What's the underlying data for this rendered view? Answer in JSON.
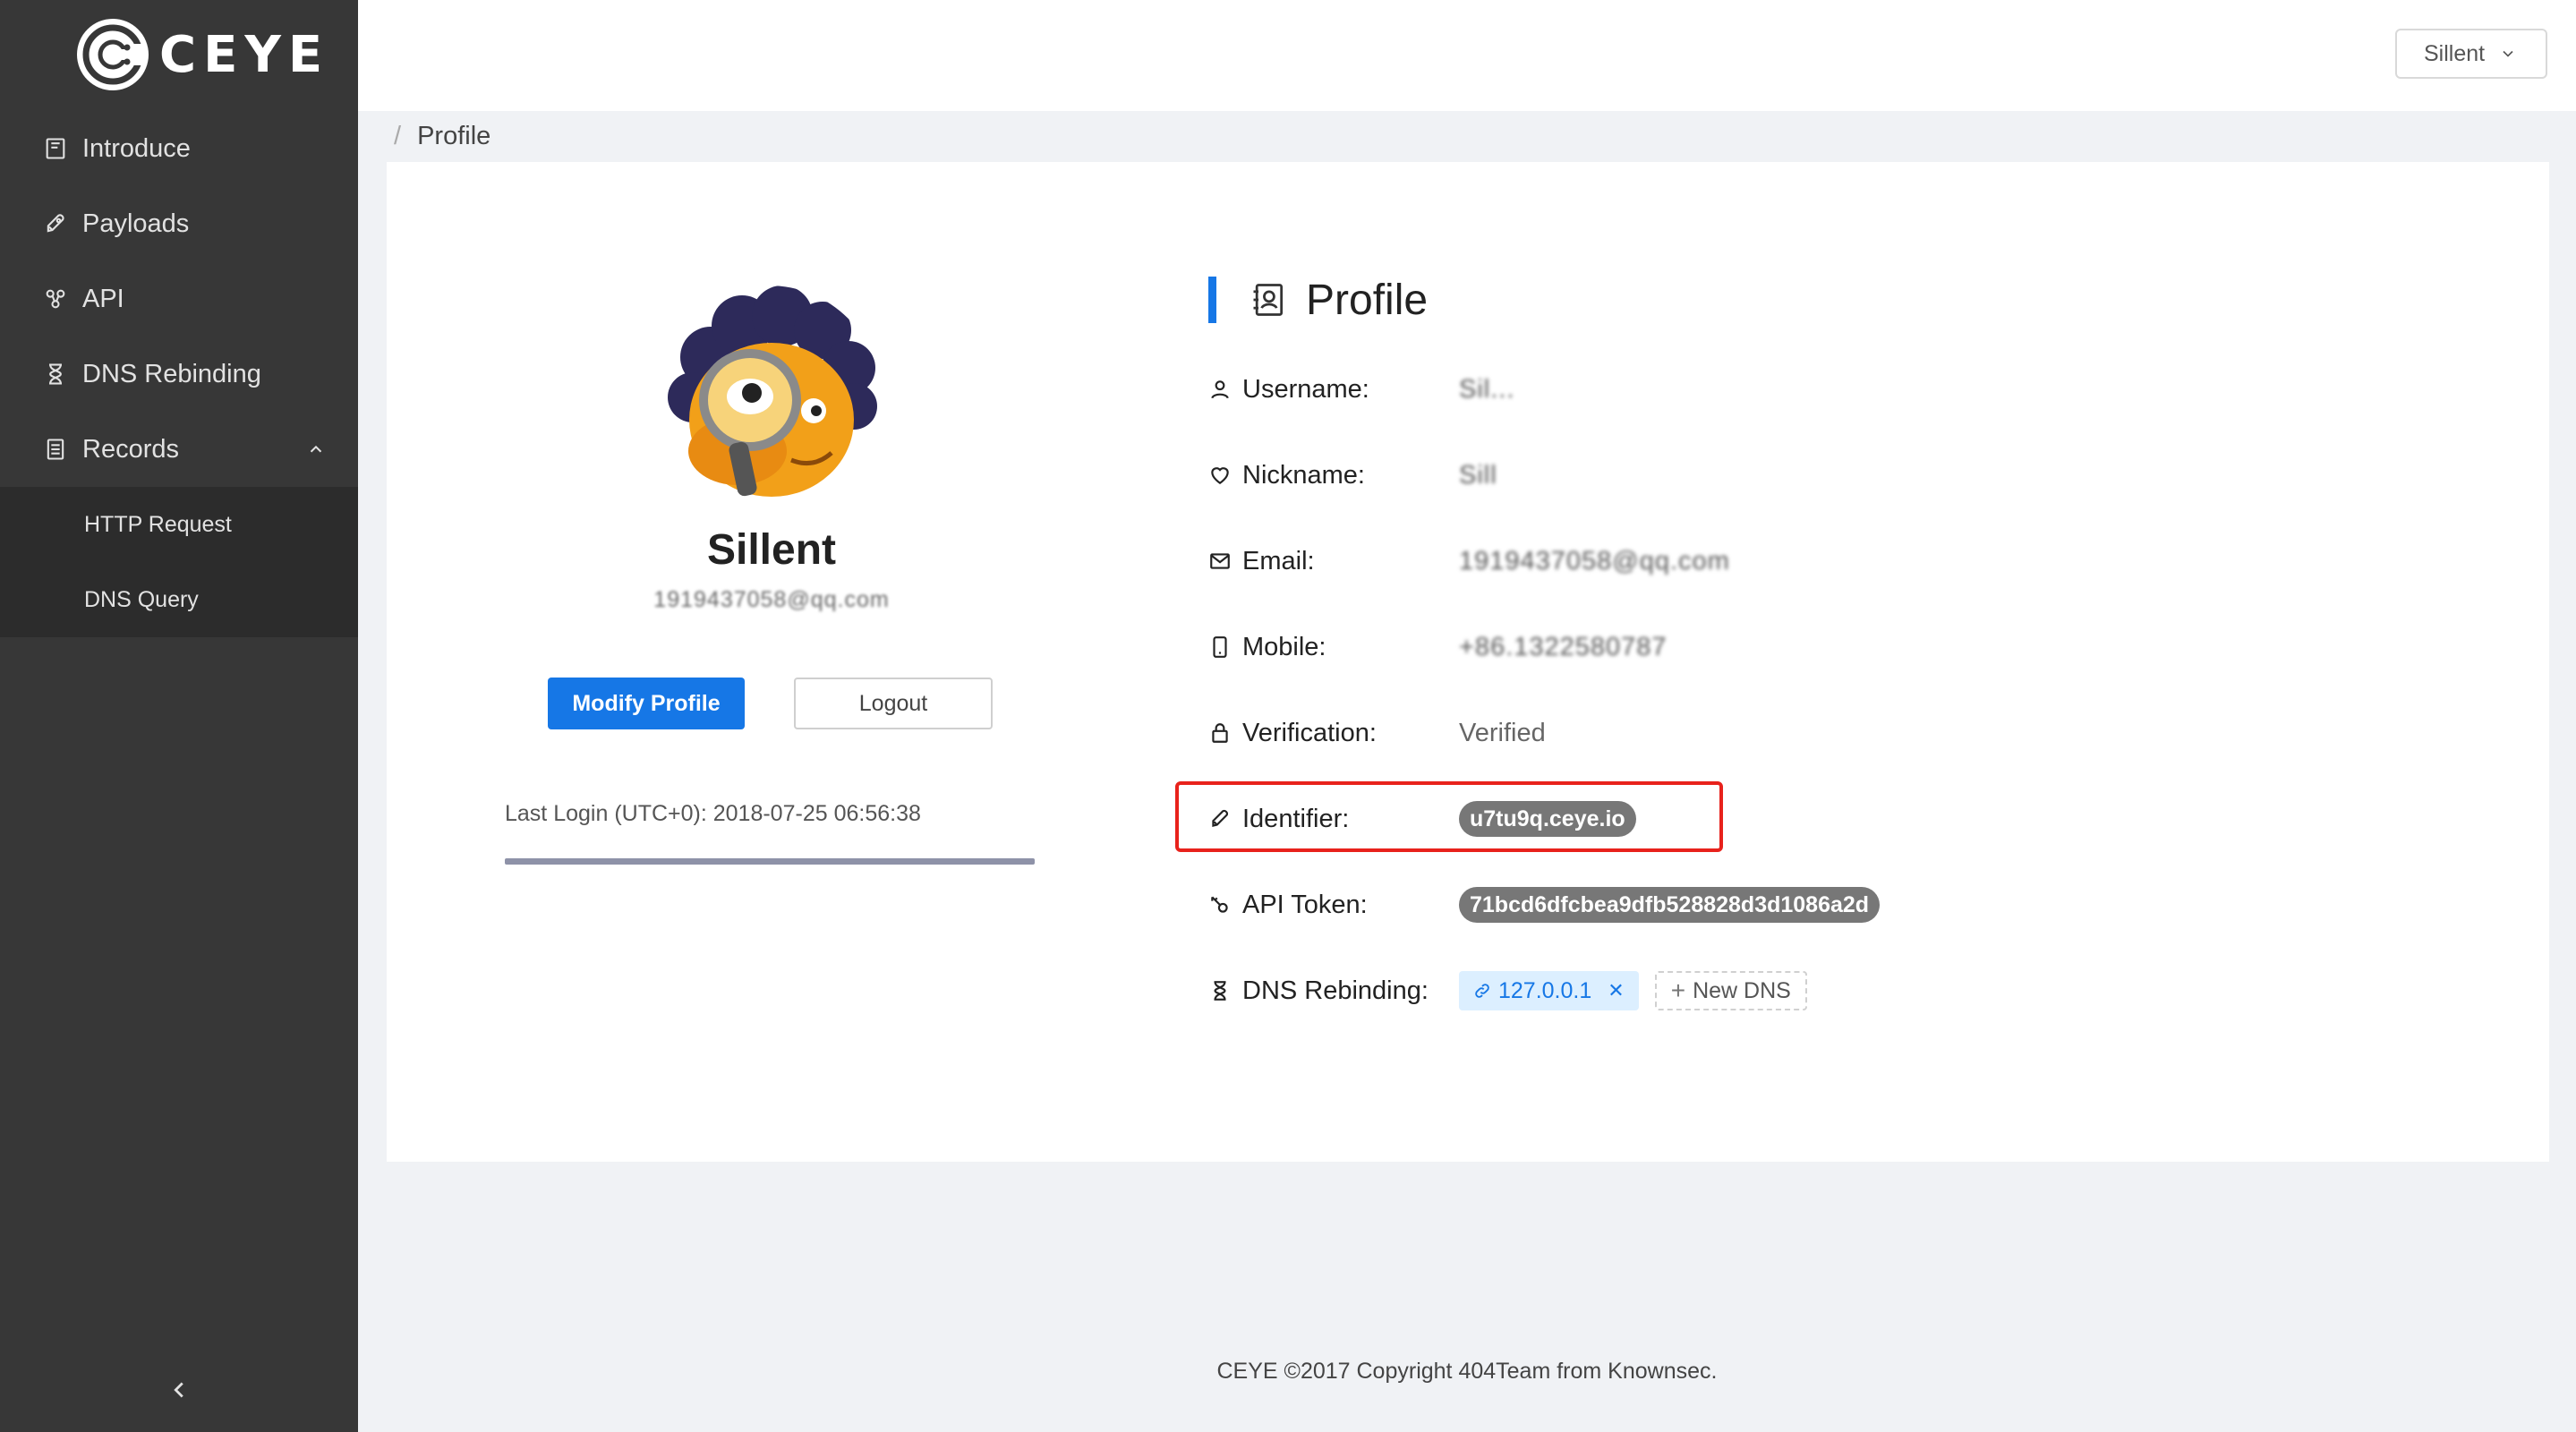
{
  "app": {
    "logo_text": "CEYE"
  },
  "sidebar": {
    "items": [
      {
        "label": "Introduce",
        "icon": "book-icon"
      },
      {
        "label": "Payloads",
        "icon": "rocket-icon"
      },
      {
        "label": "API",
        "icon": "api-icon"
      },
      {
        "label": "DNS Rebinding",
        "icon": "hourglass-icon"
      },
      {
        "label": "Records",
        "icon": "document-icon",
        "expanded": true
      }
    ],
    "records_subitems": [
      "HTTP Request",
      "DNS Query"
    ]
  },
  "header": {
    "user_menu_label": "Sillent"
  },
  "breadcrumb": {
    "separator": "/",
    "current": "Profile"
  },
  "profile_card": {
    "display_name": "Sillent",
    "email_blurred": "1919437058@qq.com",
    "modify_button": "Modify Profile",
    "logout_button": "Logout",
    "last_login": "Last Login (UTC+0): 2018-07-25 06:56:38"
  },
  "profile": {
    "title": "Profile",
    "fields": {
      "username": {
        "label": "Username:",
        "value": "Sil..."
      },
      "nickname": {
        "label": "Nickname:",
        "value": "Sill"
      },
      "email": {
        "label": "Email:",
        "value": "1919437058@qq.com"
      },
      "mobile": {
        "label": "Mobile:",
        "value": "+86.1322580787"
      },
      "verification": {
        "label": "Verification:",
        "value": "Verified"
      },
      "identifier": {
        "label": "Identifier:",
        "value": "u7tu9q.ceye.io"
      },
      "api_token": {
        "label": "API Token:",
        "value": "71bcd6dfcbea9dfb528828d3d1086a2d"
      },
      "dns_rebinding": {
        "label": "DNS Rebinding:",
        "tag": "127.0.0.1",
        "new_button": "New DNS"
      }
    }
  },
  "footer": {
    "text": "CEYE ©2017 Copyright 404Team from Knownsec."
  },
  "colors": {
    "primary": "#1677e6",
    "sidebar": "#373737",
    "highlight": "#e8221c"
  }
}
